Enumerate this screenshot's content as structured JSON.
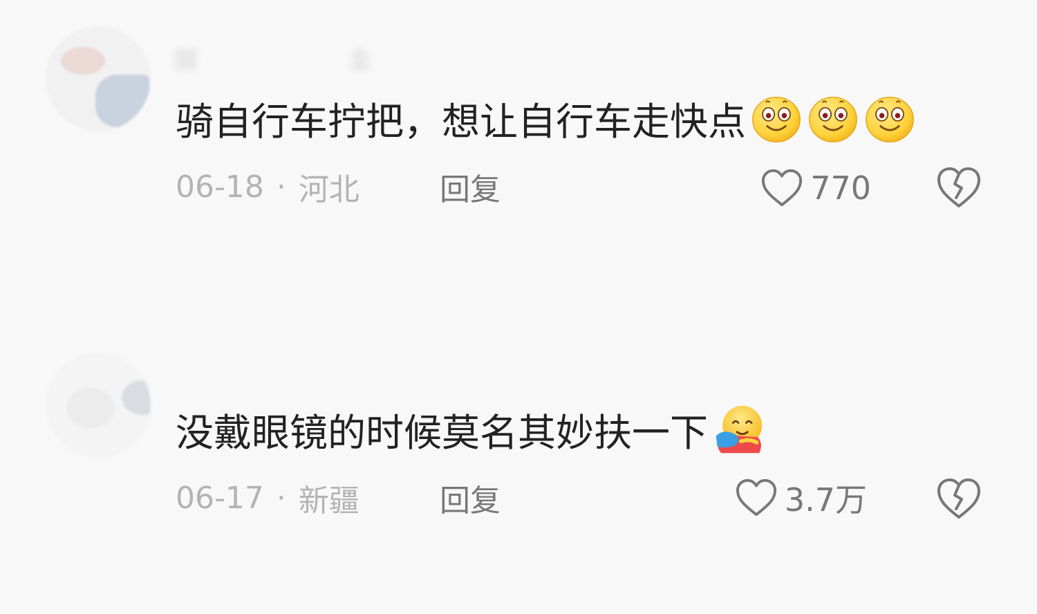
{
  "comments": [
    {
      "username": "回　　　　　　立",
      "text": "骑自行车拧把，想让自行车走快点",
      "date": "06-18",
      "location": "河北",
      "reply_label": "回复",
      "likes": "770",
      "emojis": [
        "smiley-icon",
        "smiley-icon",
        "smiley-icon"
      ]
    },
    {
      "username": "",
      "text": "没戴眼镜的时候莫名其妙扶一下",
      "date": "06-17",
      "location": "新疆",
      "reply_label": "回复",
      "likes": "3.7万",
      "emojis": [
        "hug-icon"
      ]
    }
  ],
  "colors": {
    "background": "#f8f8f8",
    "text": "#222222",
    "meta": "#b3b3b3",
    "action": "#777777"
  }
}
